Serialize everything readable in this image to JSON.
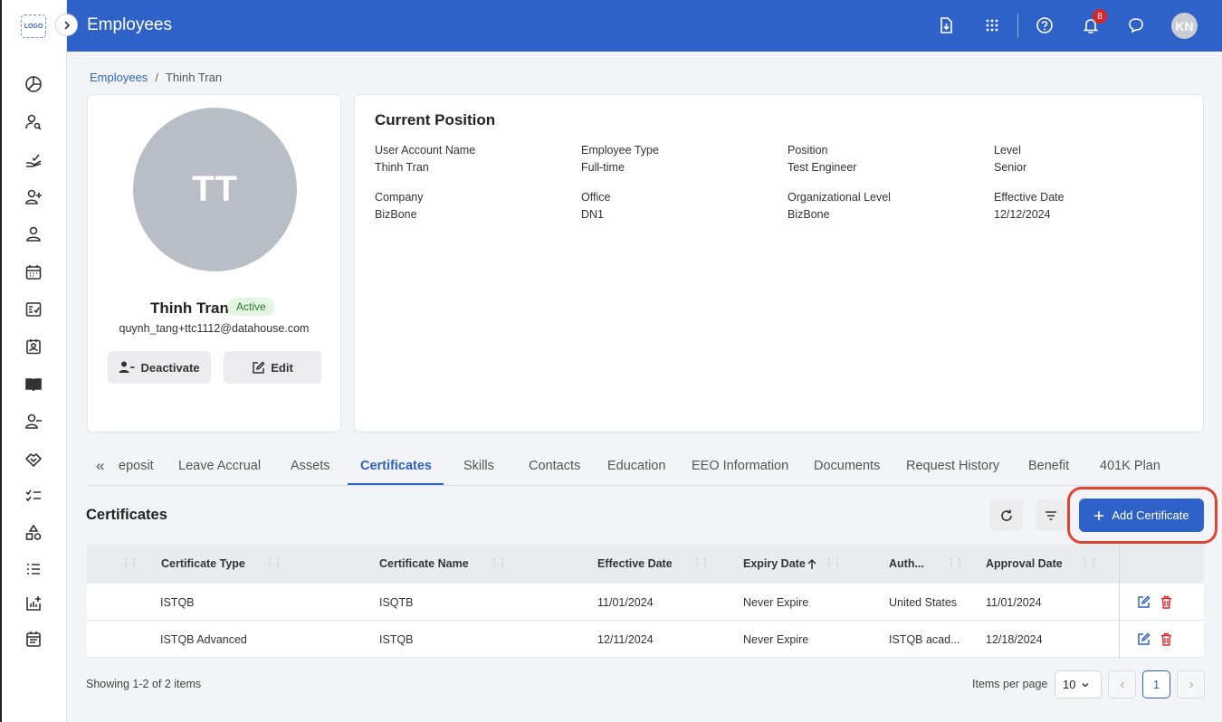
{
  "app": {
    "logo_text": "LOGO",
    "header_title": "Employees",
    "notification_count": "8",
    "user_initials": "KN"
  },
  "breadcrumb": {
    "root": "Employees",
    "separator": "/",
    "current": "Thinh Tran"
  },
  "profile": {
    "initials": "TT",
    "name": "Thinh Tran",
    "status": "Active",
    "email": "quynh_tang+ttc1112@datahouse.com",
    "deactivate_label": "Deactivate",
    "edit_label": "Edit"
  },
  "position": {
    "title": "Current Position",
    "fields": [
      {
        "label": "User Account Name",
        "value": "Thinh Tran"
      },
      {
        "label": "Employee Type",
        "value": "Full-time"
      },
      {
        "label": "Position",
        "value": "Test Engineer"
      },
      {
        "label": "Level",
        "value": "Senior"
      },
      {
        "label": "Company",
        "value": "BizBone"
      },
      {
        "label": "Office",
        "value": "DN1"
      },
      {
        "label": "Organizational Level",
        "value": "BizBone"
      },
      {
        "label": "Effective Date",
        "value": "12/12/2024"
      }
    ]
  },
  "tabs": [
    {
      "label": "eposit"
    },
    {
      "label": "Leave Accrual"
    },
    {
      "label": "Assets"
    },
    {
      "label": "Certificates"
    },
    {
      "label": "Skills"
    },
    {
      "label": "Contacts"
    },
    {
      "label": "Education"
    },
    {
      "label": "EEO Information"
    },
    {
      "label": "Documents"
    },
    {
      "label": "Request History"
    },
    {
      "label": "Benefit"
    },
    {
      "label": "401K Plan"
    }
  ],
  "tabs_scroll_glyph": "«",
  "certificates": {
    "title": "Certificates",
    "add_label": "Add Certificate",
    "columns": [
      "Certificate Type",
      "Certificate Name",
      "Effective Date",
      "Expiry Date",
      "Auth...",
      "Approval Date"
    ],
    "rows": [
      {
        "type": "ISTQB",
        "name": "ISQTB",
        "effective": "11/01/2024",
        "expiry": "Never Expire",
        "auth": "United States",
        "approval": "11/01/2024"
      },
      {
        "type": "ISTQB Advanced",
        "name": "ISTQB",
        "effective": "12/11/2024",
        "expiry": "Never Expire",
        "auth": "ISTQB acad...",
        "approval": "12/18/2024"
      }
    ],
    "footer": "Showing 1-2 of 2 items",
    "items_per_page_label": "Items per page",
    "items_per_page": "10",
    "current_page": "1"
  },
  "colors": {
    "primary": "#2f62c9",
    "highlight": "#e2432e",
    "status_bg": "#e3f5e3"
  }
}
